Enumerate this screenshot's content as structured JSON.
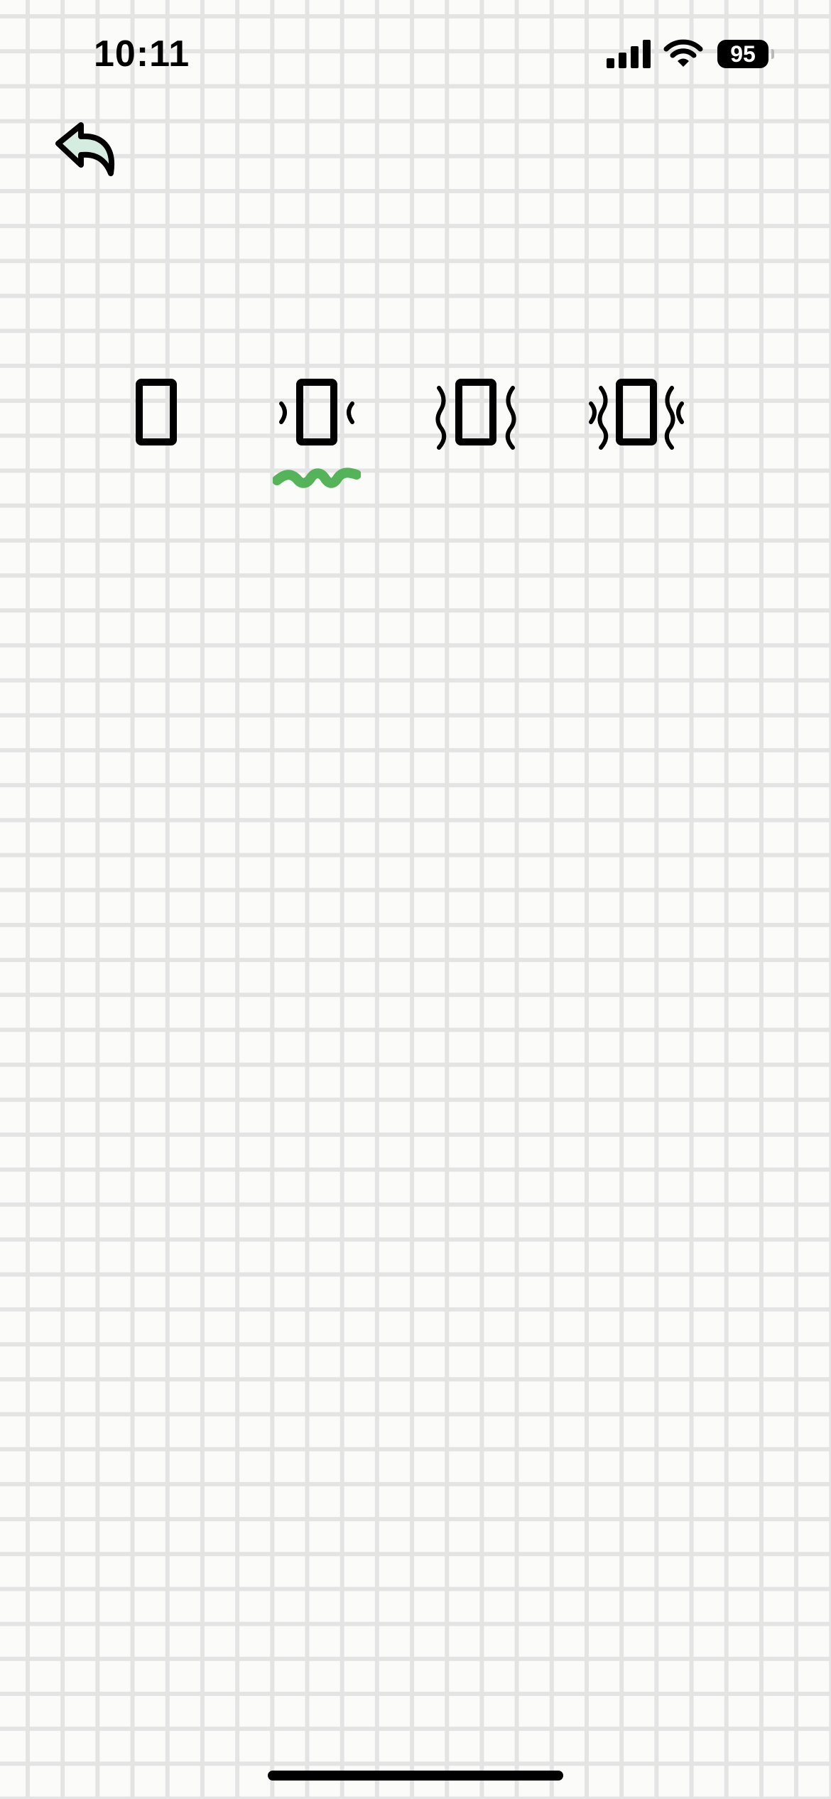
{
  "status_bar": {
    "time": "10:11",
    "battery_level": "95",
    "signal_icon": "cellular-signal-icon",
    "wifi_icon": "wifi-icon"
  },
  "back_button": {
    "icon": "back-arrow-icon",
    "fill_color": "#d5ece0",
    "stroke_color": "#000000"
  },
  "vibration_levels": {
    "options": [
      {
        "level": 0,
        "icon": "vibration-off-icon"
      },
      {
        "level": 1,
        "icon": "vibration-low-icon"
      },
      {
        "level": 2,
        "icon": "vibration-medium-icon"
      },
      {
        "level": 3,
        "icon": "vibration-high-icon"
      }
    ],
    "selected_level": 1,
    "selected_color": "#4caf50"
  },
  "colors": {
    "background": "#fbfbf9",
    "grid": "#e4e4e4",
    "ink": "#000000"
  }
}
